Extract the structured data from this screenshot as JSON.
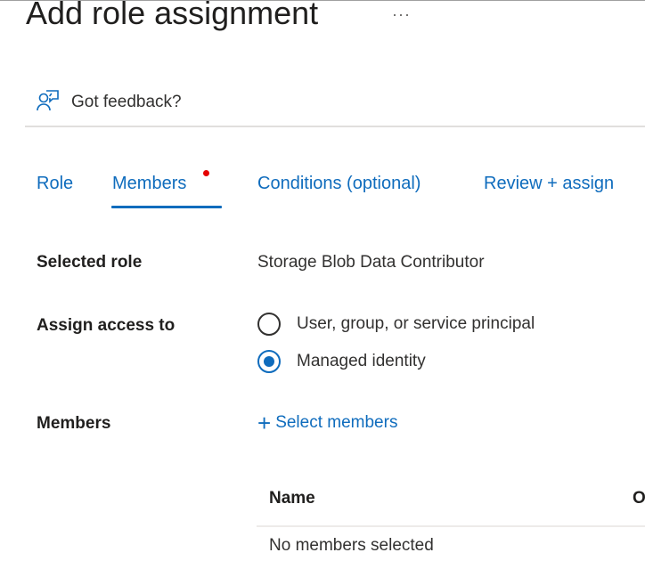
{
  "header": {
    "title": "Add role assignment",
    "more_label": "···"
  },
  "feedback": {
    "icon": "person-feedback-icon",
    "label": "Got feedback?"
  },
  "tabs": [
    {
      "label": "Role",
      "active": false
    },
    {
      "label": "Members",
      "active": true,
      "has_required_indicator": true
    },
    {
      "label": "Conditions (optional)",
      "active": false
    },
    {
      "label": "Review + assign",
      "active": false
    }
  ],
  "form": {
    "selected_role": {
      "label": "Selected role",
      "value": "Storage Blob Data Contributor"
    },
    "assign_access_to": {
      "label": "Assign access to",
      "options": [
        {
          "label": "User, group, or service principal",
          "checked": false
        },
        {
          "label": "Managed identity",
          "checked": true
        }
      ]
    },
    "members": {
      "label": "Members",
      "select_button_icon": "plus-icon",
      "select_button_label": "Select members"
    }
  },
  "members_table": {
    "columns": [
      "Name",
      "O"
    ],
    "empty_message": "No members selected"
  },
  "colors": {
    "accent": "#0f6cbd",
    "required_dot": "#e50000",
    "text": "#323130"
  }
}
